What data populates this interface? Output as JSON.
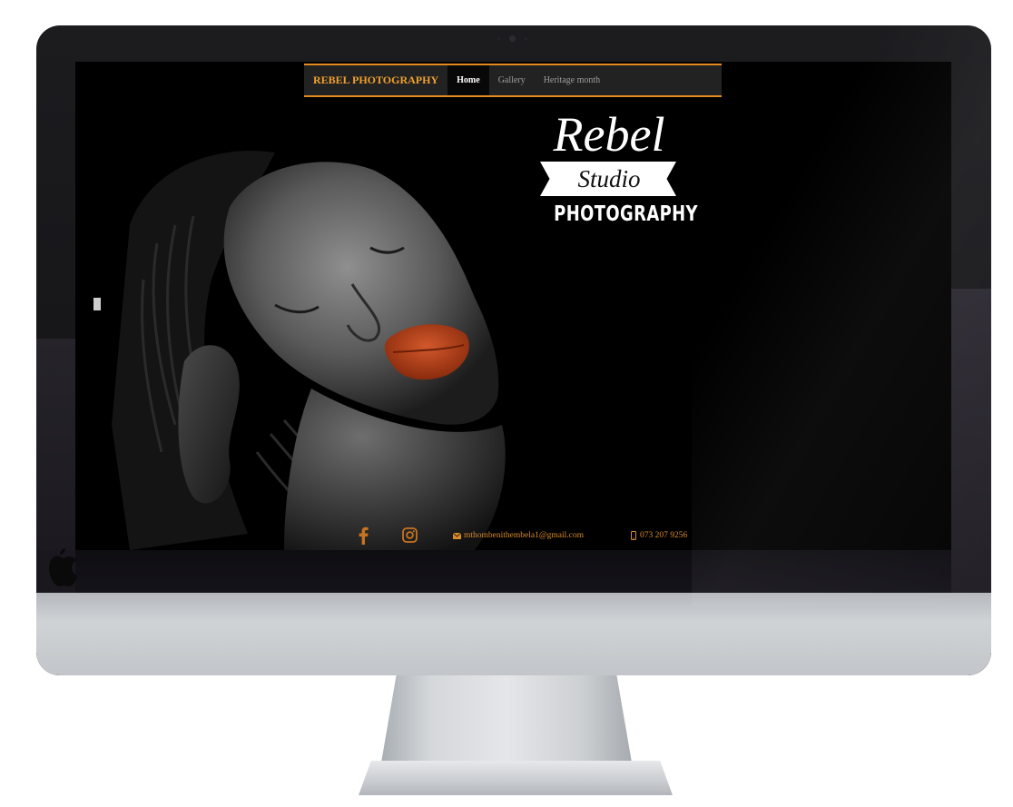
{
  "navbar": {
    "brand": "REBEL PHOTOGRAPHY",
    "items": [
      {
        "label": "Home",
        "active": true
      },
      {
        "label": "Gallery",
        "active": false
      },
      {
        "label": "Heritage month",
        "active": false
      }
    ]
  },
  "logo": {
    "rebel": "Rebel",
    "studio": "Studio",
    "photography": "PHOTOGRAPHY"
  },
  "contact": {
    "email": "mthombenithembela1@gmail.com",
    "phone": "073 207 9256"
  },
  "icons": {
    "facebook": "facebook-icon",
    "instagram": "instagram-icon",
    "email": "envelope-icon",
    "phone": "phone-icon"
  },
  "colors": {
    "accent": "#e38b1c",
    "brand_text": "#f0a12f",
    "contact_text": "#d88a2a",
    "navbar_bg": "#222222"
  }
}
